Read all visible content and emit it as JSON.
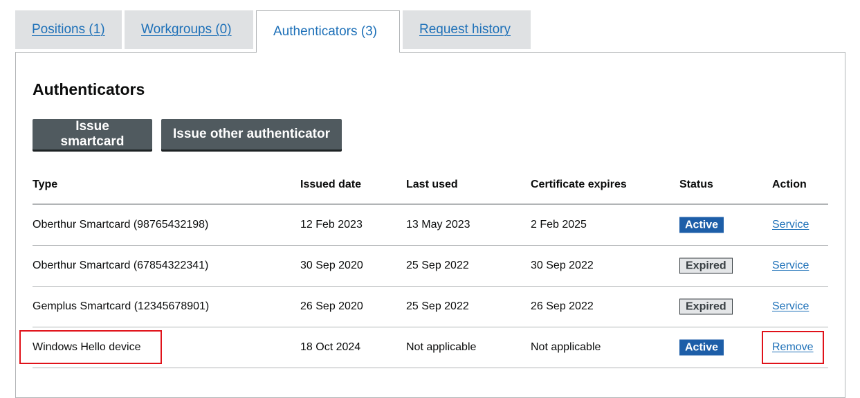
{
  "tabs": [
    {
      "label": "Positions (1)",
      "selected": false
    },
    {
      "label": "Workgroups (0)",
      "selected": false
    },
    {
      "label": "Authenticators (3)",
      "selected": true
    },
    {
      "label": "Request history",
      "selected": false
    }
  ],
  "section": {
    "heading": "Authenticators",
    "buttons": {
      "issue_smartcard": "Issue smartcard",
      "issue_other": "Issue other authenticator"
    }
  },
  "table": {
    "headers": {
      "type": "Type",
      "issued": "Issued date",
      "last_used": "Last used",
      "cert": "Certificate expires",
      "status": "Status",
      "action": "Action"
    },
    "rows": [
      {
        "type": "Oberthur Smartcard (98765432198)",
        "issued": "12 Feb 2023",
        "last_used": "13 May 2023",
        "cert": "2 Feb 2025",
        "status": "Active",
        "action": "Service"
      },
      {
        "type": "Oberthur Smartcard (67854322341)",
        "issued": "30 Sep 2020",
        "last_used": "25 Sep 2022",
        "cert": "30 Sep 2022",
        "status": "Expired",
        "action": "Service"
      },
      {
        "type": "Gemplus Smartcard (12345678901)",
        "issued": "26 Sep 2020",
        "last_used": "25 Sep 2022",
        "cert": "26 Sep 2022",
        "status": "Expired",
        "action": "Service"
      },
      {
        "type": "Windows Hello device",
        "issued": "18 Oct 2024",
        "last_used": "Not applicable",
        "cert": "Not applicable",
        "status": "Active",
        "action": "Remove"
      }
    ]
  },
  "colors": {
    "link": "#1d70b8",
    "button": "#505a5f",
    "tag_active": "#1d5ea8",
    "tag_expired_bg": "#e4e6e8",
    "highlight": "#e0121a"
  }
}
